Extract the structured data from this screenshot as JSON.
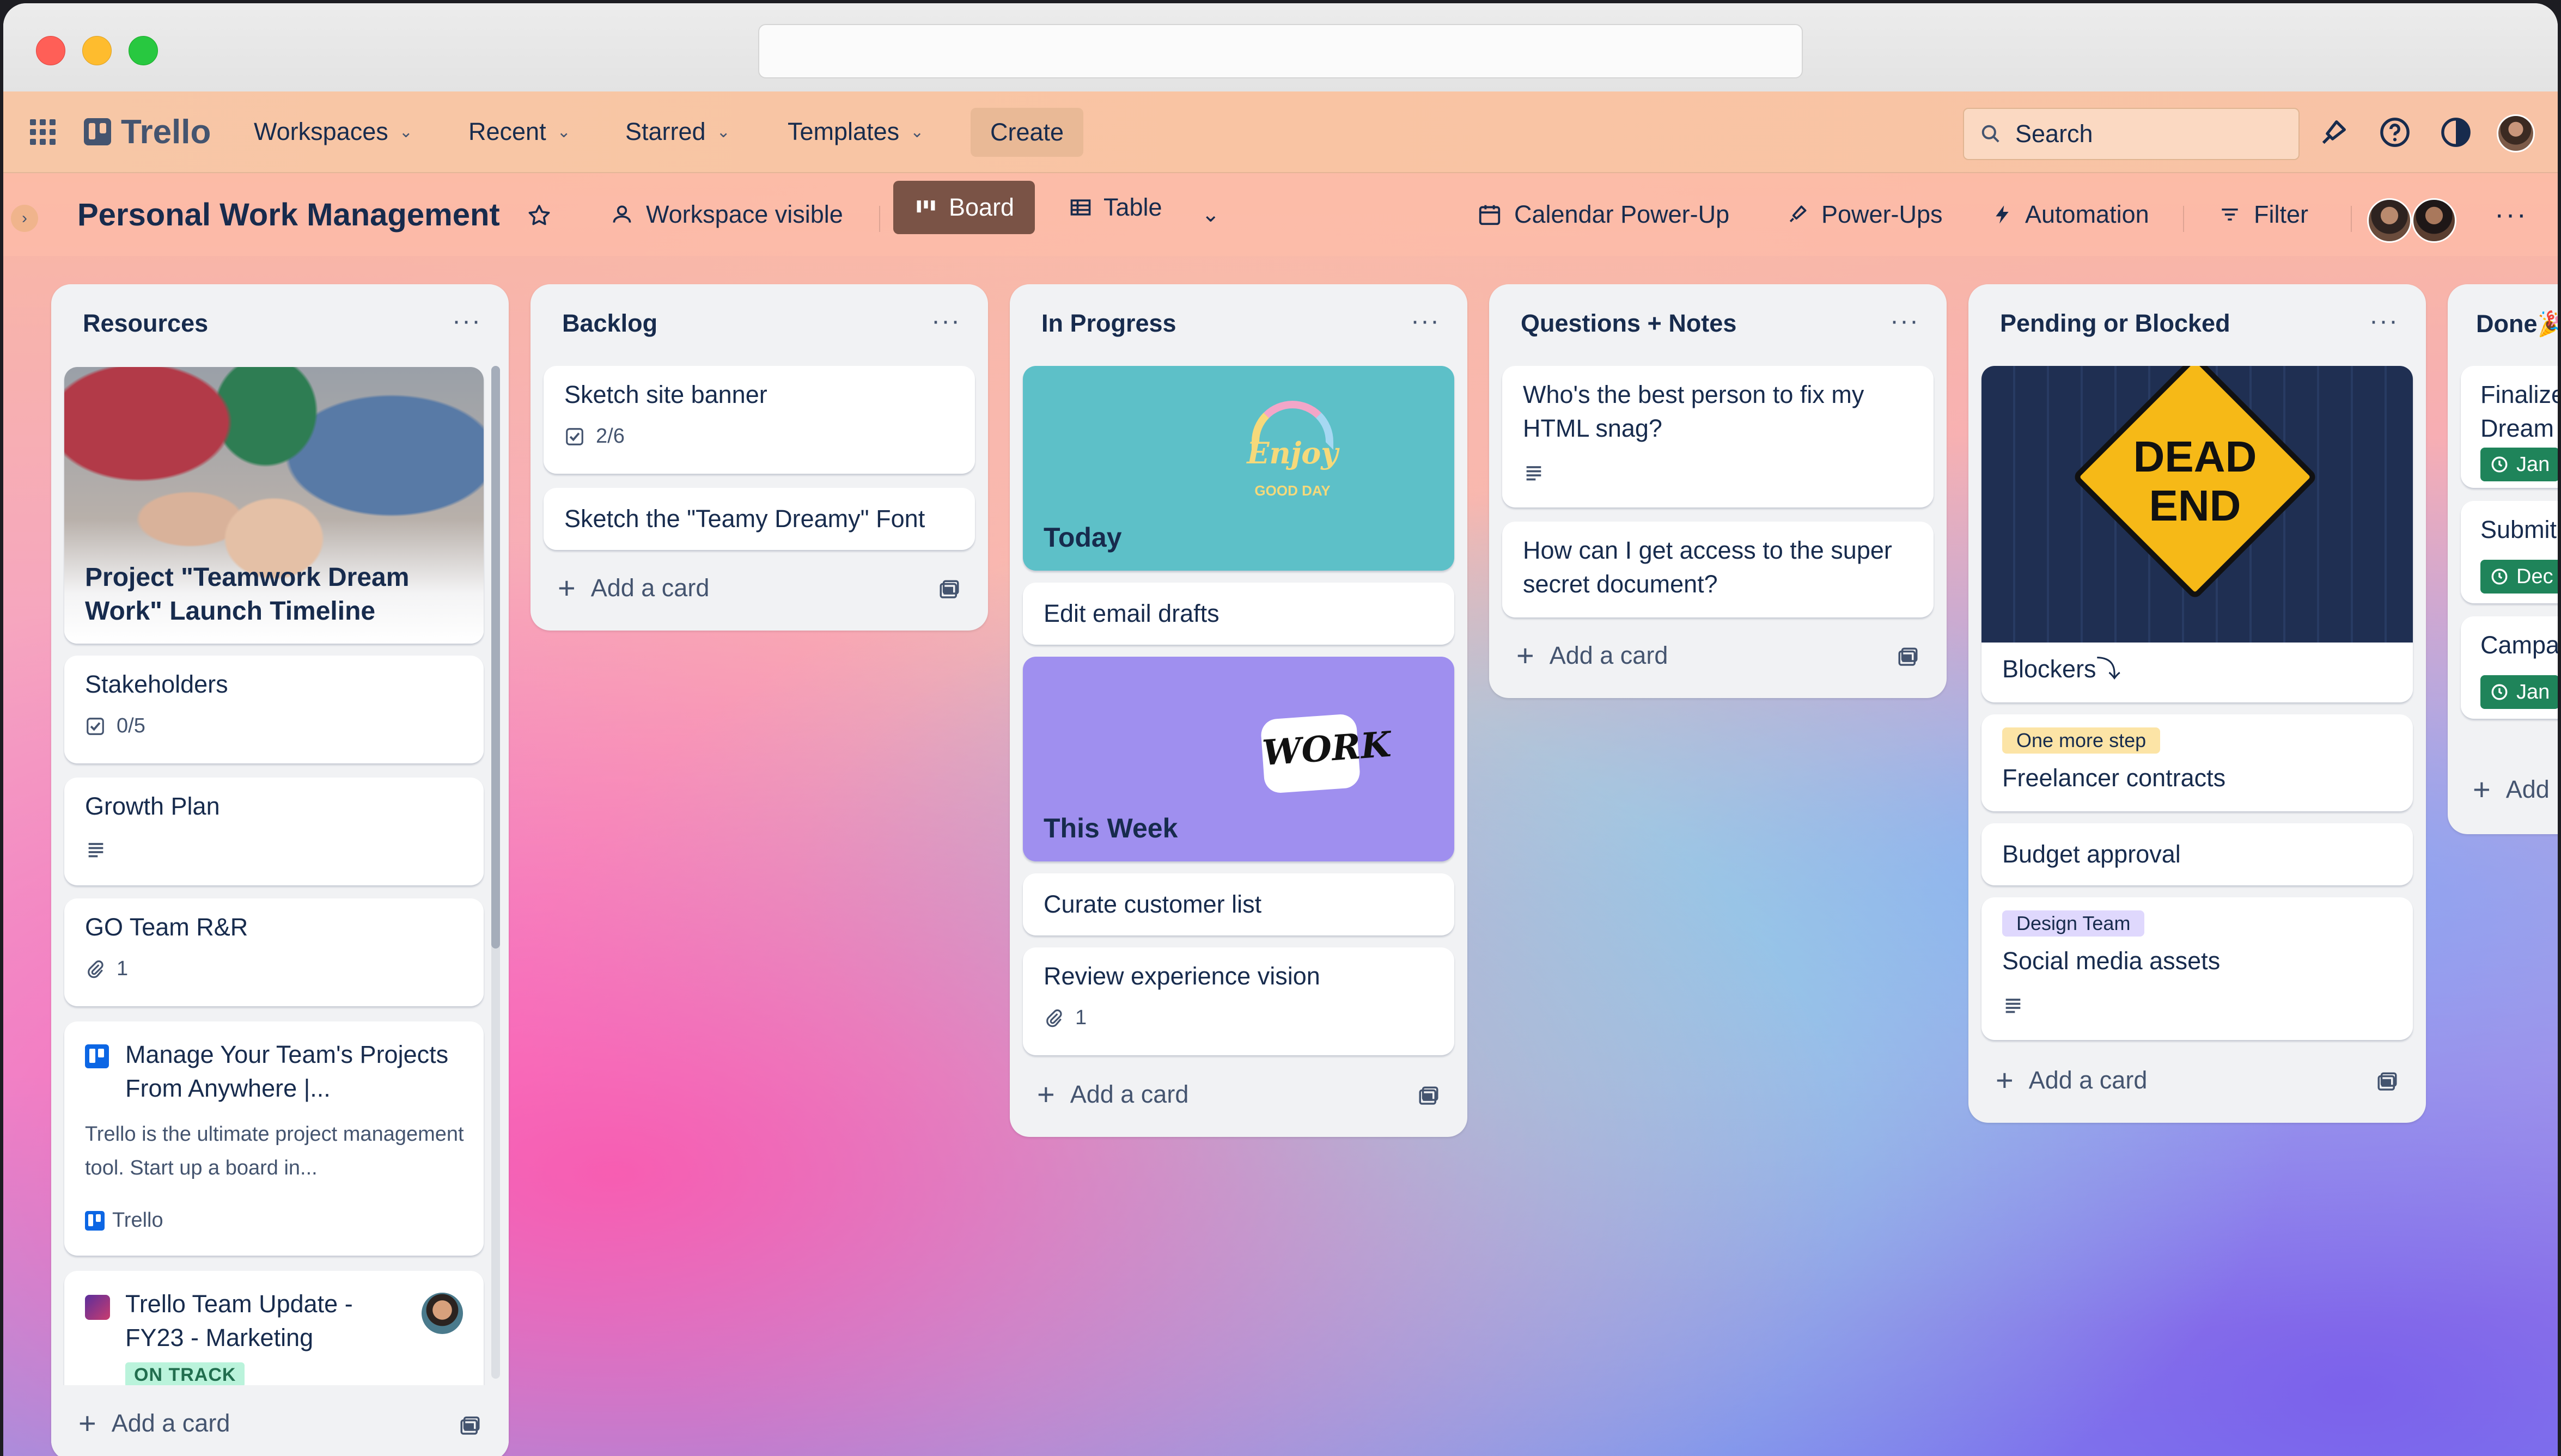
{
  "header": {
    "app_name": "Trello",
    "menus": [
      "Workspaces",
      "Recent",
      "Starred",
      "Templates"
    ],
    "create_label": "Create",
    "search_placeholder": "Search"
  },
  "board": {
    "title": "Personal Work Management",
    "visibility": "Workspace visible",
    "view_board": "Board",
    "view_table": "Table",
    "calendar": "Calendar Power-Up",
    "powerups": "Power-Ups",
    "automation": "Automation",
    "filter": "Filter"
  },
  "lists": {
    "resources": {
      "title": "Resources",
      "cards": {
        "cover": "Project \"Teamwork Dream Work\" Launch Timeline",
        "stakeholders": "Stakeholders",
        "stakeholders_checklist": "0/5",
        "growth": "Growth Plan",
        "go_team": "GO Team R&R",
        "go_team_attachments": "1",
        "manage_title": "Manage Your Team's Projects From Anywhere |...",
        "manage_desc": "Trello is the ultimate project management tool. Start up a board in...",
        "manage_source": "Trello",
        "update_title": "Trello Team Update - FY23 - Marketing",
        "update_status": "ON TRACK"
      },
      "add_card": "Add a card"
    },
    "backlog": {
      "title": "Backlog",
      "cards": {
        "banner": "Sketch site banner",
        "banner_checklist": "2/6",
        "font": "Sketch the \"Teamy Dreamy\" Font"
      },
      "add_card": "Add a card"
    },
    "in_progress": {
      "title": "In Progress",
      "cards": {
        "today": "Today",
        "today_sticker_top": "Enjoy",
        "today_sticker_bottom": "GOOD DAY",
        "email": "Edit email drafts",
        "week": "This Week",
        "week_sticker": "WORK",
        "curate": "Curate customer list",
        "review": "Review experience vision",
        "review_attachments": "1"
      },
      "add_card": "Add a card"
    },
    "questions": {
      "title": "Questions + Notes",
      "cards": {
        "q1": "Who's the best person to fix my HTML snag?",
        "q2": "How can I get access to the super secret document?"
      },
      "add_card": "Add a card"
    },
    "pending": {
      "title": "Pending or Blocked",
      "cards": {
        "sign_top": "DEAD",
        "sign_bottom": "END",
        "blockers": "Blockers⤵",
        "freelancer_label": "One more step",
        "freelancer": "Freelancer contracts",
        "budget": "Budget approval",
        "social_label": "Design Team",
        "social": "Social media assets"
      },
      "add_card": "Add a card"
    },
    "done": {
      "title": "Done🎉",
      "cards": {
        "c1": "Finalize",
        "c1b": "Dream",
        "c1_due": "Jan",
        "c2": "Submit",
        "c2_due": "Dec",
        "c3": "Campa",
        "c3_due": "Jan"
      },
      "add_card": "Add"
    }
  },
  "colors": {
    "accent": "#0c66e4",
    "board_button_bg": "#7a5346",
    "label_orange": "#fce4a6",
    "label_purple": "#dfd8fd",
    "due_green": "#1f845a",
    "today_cover": "#5dc0c8",
    "week_cover": "#9f8fef"
  }
}
